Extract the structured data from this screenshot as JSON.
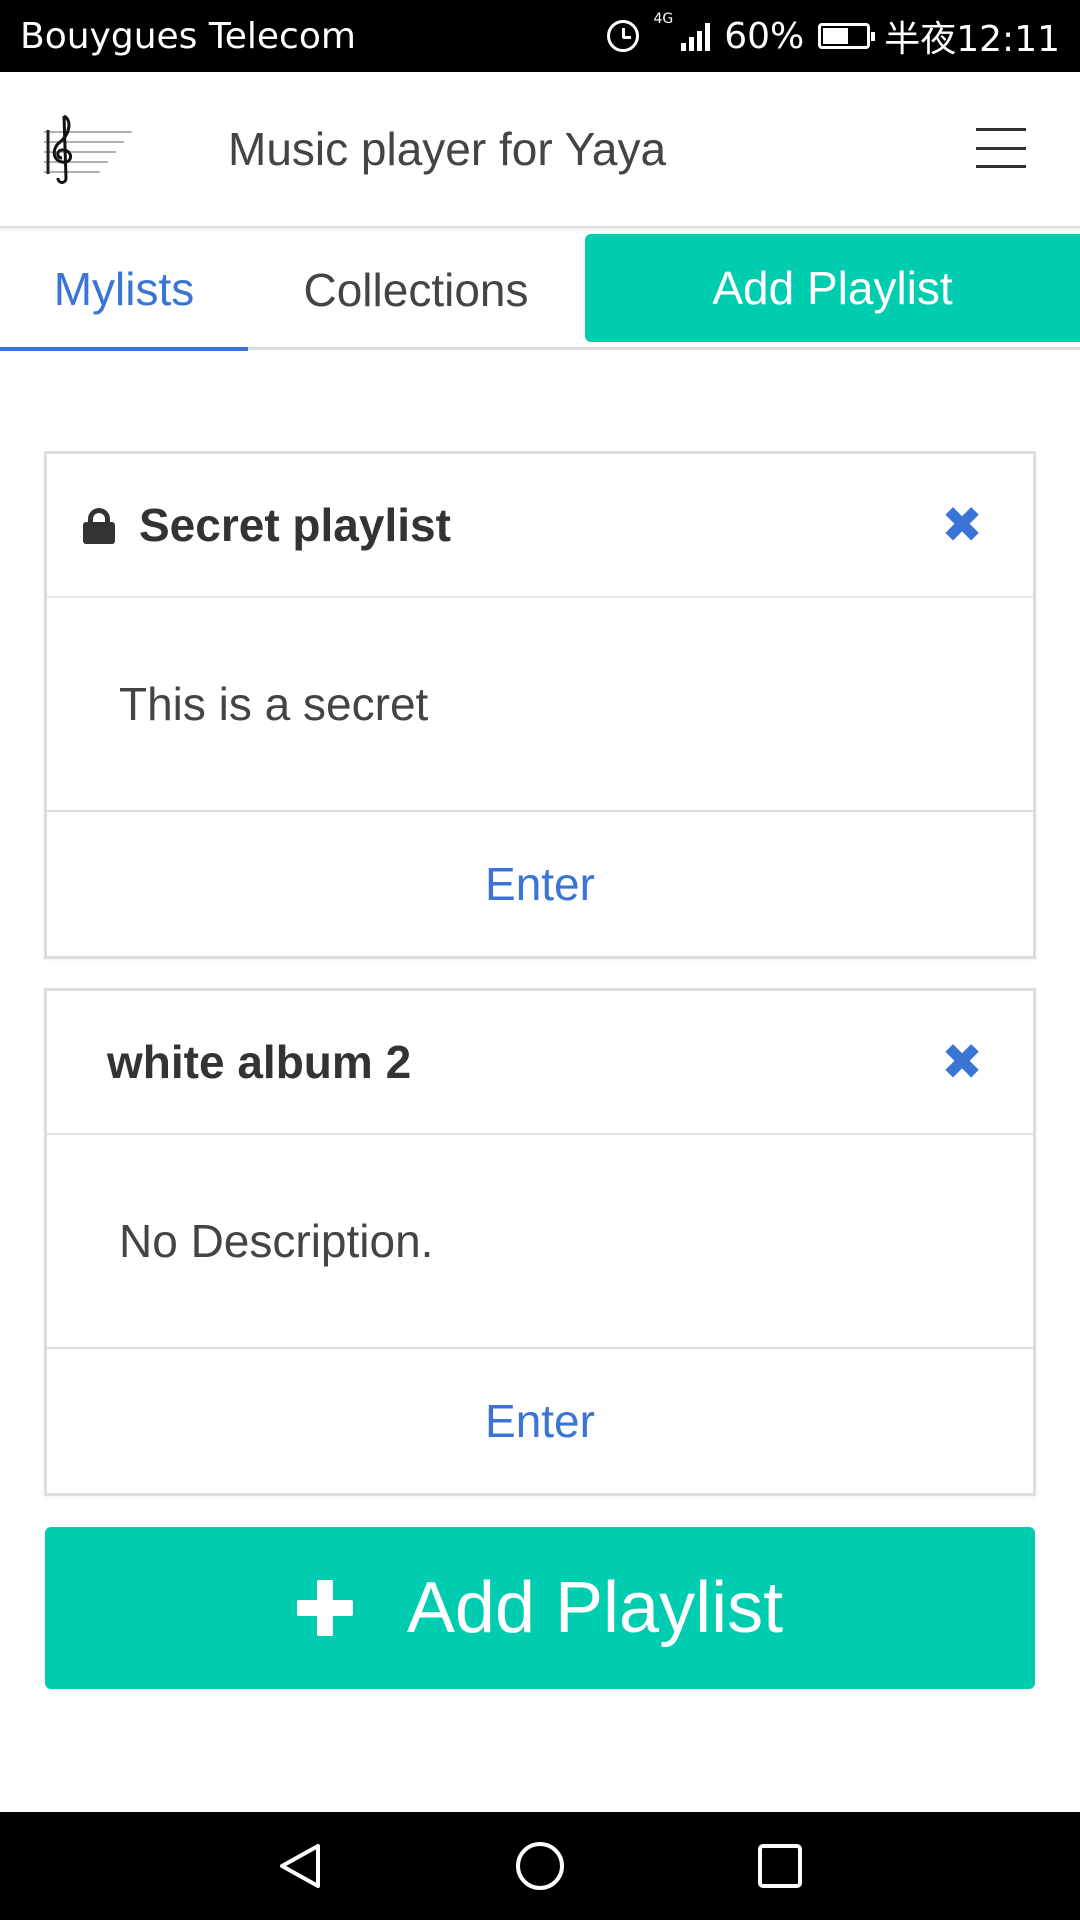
{
  "status_bar": {
    "carrier": "Bouygues Telecom",
    "network": "4G",
    "battery": "60%",
    "time": "半夜12:11"
  },
  "header": {
    "title": "Music player for Yaya",
    "logo_icon": "treble-clef-icon",
    "menu_icon": "hamburger-menu-icon"
  },
  "tabs": [
    {
      "label": "Mylists",
      "active": true
    },
    {
      "label": "Collections",
      "active": false
    },
    {
      "label": "Add Playlist",
      "active": false
    }
  ],
  "playlists": [
    {
      "title": "Secret playlist",
      "locked": true,
      "description": "This is a secret",
      "action": "Enter"
    },
    {
      "title": "white album 2",
      "locked": false,
      "description": "No Description.",
      "action": "Enter"
    }
  ],
  "add_button": {
    "label": "Add Playlist",
    "icon": "plus-icon"
  },
  "colors": {
    "accent": "#00cdb0",
    "link": "#3a75d6",
    "text": "#333333"
  }
}
